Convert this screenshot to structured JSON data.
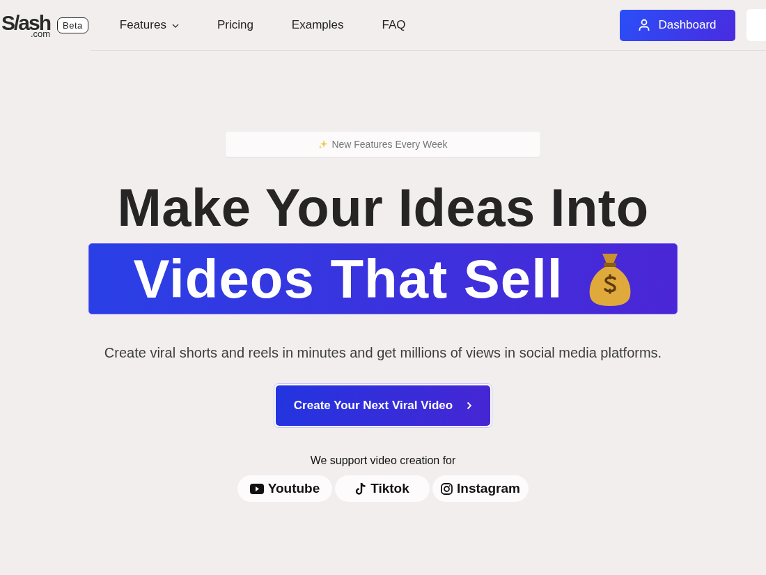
{
  "header": {
    "logo": "S/ash",
    "logo_suffix": ".com",
    "badge": "Beta",
    "nav": [
      {
        "label": "Features",
        "dropdown": true
      },
      {
        "label": "Pricing",
        "dropdown": false
      },
      {
        "label": "Examples",
        "dropdown": false
      },
      {
        "label": "FAQ",
        "dropdown": false
      }
    ],
    "dashboard_button": "Dashboard"
  },
  "hero": {
    "pill": "New Features Every Week",
    "title_line1": "Make Your Ideas Into",
    "title_line2": "Videos That Sell",
    "subtitle": "Create viral shorts and reels in minutes and get millions of views in social media platforms.",
    "cta": "Create Your Next Viral Video",
    "support_text": "We support video creation for",
    "platforms": [
      {
        "label": "Youtube",
        "kind": "youtube"
      },
      {
        "label": "Tiktok",
        "kind": "tiktok"
      },
      {
        "label": "Instagram",
        "kind": "instagram"
      }
    ]
  }
}
